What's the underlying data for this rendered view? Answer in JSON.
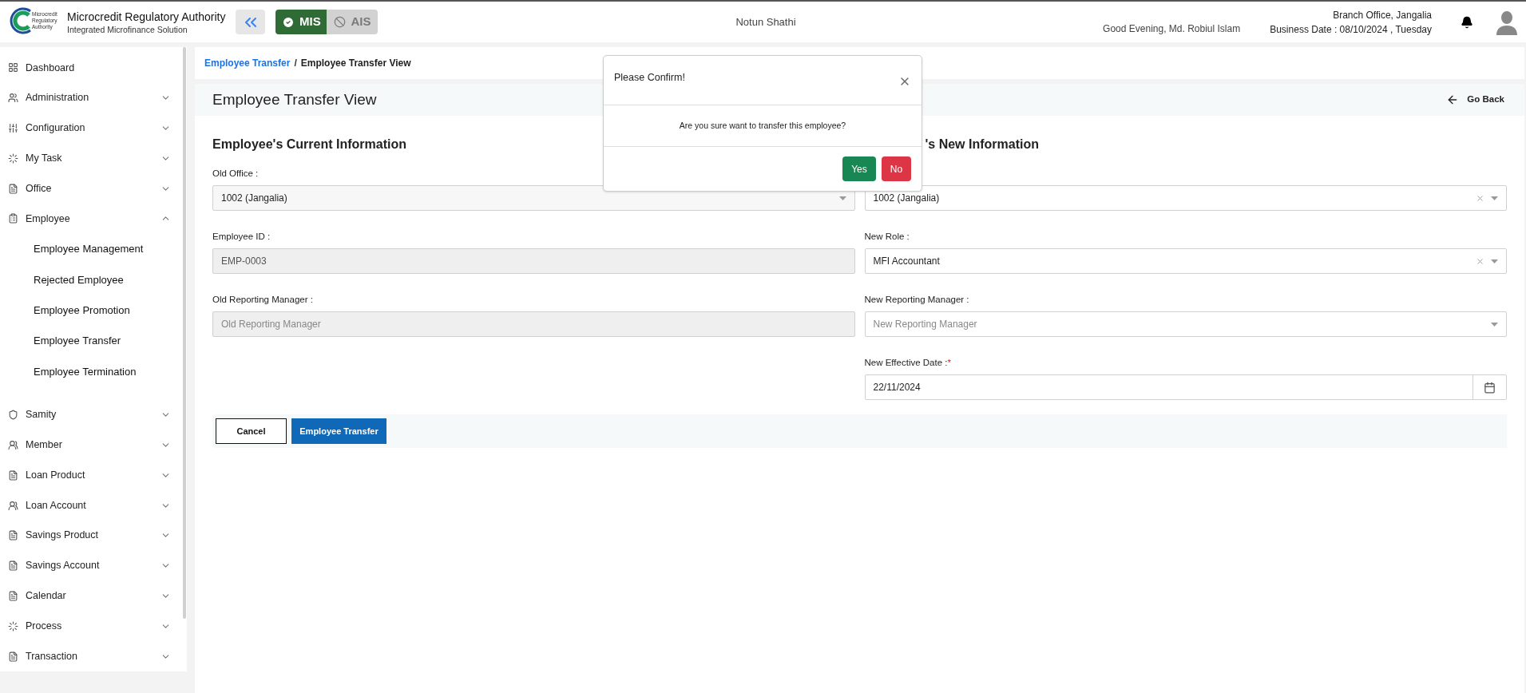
{
  "header": {
    "org_title": "Microcredit Regulatory Authority",
    "org_subtitle": "Integrated Microfinance Solution",
    "logo_text": "Microcredit Regulatory Authority",
    "modes": [
      {
        "label": "MIS",
        "selected": true
      },
      {
        "label": "AIS",
        "selected": false
      }
    ],
    "center_title": "Notun Shathi",
    "greeting": "Good Evening, Md. Robiul Islam",
    "branch": "Branch Office, Jangalia",
    "business_date": "Business Date : 08/10/2024 , Tuesday"
  },
  "sidebar": {
    "items": [
      {
        "label": "Dashboard",
        "kind": "link",
        "expanded": false
      },
      {
        "label": "Administration",
        "kind": "group",
        "expanded": false
      },
      {
        "label": "Configuration",
        "kind": "group",
        "expanded": false
      },
      {
        "label": "My Task",
        "kind": "group",
        "expanded": false
      },
      {
        "label": "Office",
        "kind": "group",
        "expanded": false
      },
      {
        "label": "Employee",
        "kind": "group",
        "expanded": true,
        "children": [
          {
            "label": "Employee Management"
          },
          {
            "label": "Rejected Employee"
          },
          {
            "label": "Employee Promotion"
          },
          {
            "label": "Employee Transfer"
          },
          {
            "label": "Employee Termination"
          }
        ]
      },
      {
        "label": "Samity",
        "kind": "group",
        "expanded": false
      },
      {
        "label": "Member",
        "kind": "group",
        "expanded": false
      },
      {
        "label": "Loan Product",
        "kind": "group",
        "expanded": false
      },
      {
        "label": "Loan Account",
        "kind": "group",
        "expanded": false
      },
      {
        "label": "Savings Product",
        "kind": "group",
        "expanded": false
      },
      {
        "label": "Savings Account",
        "kind": "group",
        "expanded": false
      },
      {
        "label": "Calendar",
        "kind": "group",
        "expanded": false
      },
      {
        "label": "Process",
        "kind": "group",
        "expanded": false
      },
      {
        "label": "Transaction",
        "kind": "group",
        "expanded": false
      }
    ]
  },
  "breadcrumb": {
    "separator": "/",
    "items": [
      {
        "label": "Employee Transfer",
        "kind": "link"
      },
      {
        "label": "Employee Transfer View",
        "kind": "current"
      }
    ]
  },
  "page": {
    "title": "Employee Transfer View",
    "go_back": "Go Back",
    "current": {
      "heading": "Employee's Current Information",
      "fields": [
        {
          "label": "Old Office :",
          "kind": "select",
          "value": "1002 (Jangalia)",
          "disabled": false
        },
        {
          "label": "Employee ID :",
          "kind": "text",
          "value": "EMP-0003",
          "disabled": true
        },
        {
          "label": "Old Reporting Manager :",
          "kind": "text",
          "placeholder": "Old Reporting Manager",
          "disabled": true
        }
      ]
    },
    "new": {
      "heading": "'s New Information",
      "fields": [
        {
          "kind": "select",
          "value": "1002 (Jangalia)",
          "clearable": true,
          "disabled": false
        },
        {
          "label": "New Role :",
          "kind": "select",
          "value": "MFI Accountant",
          "clearable": true,
          "disabled": false
        },
        {
          "label": "New Reporting Manager :",
          "kind": "select",
          "placeholder": "New Reporting Manager",
          "clearable": false,
          "disabled": false
        },
        {
          "label": "New Effective Date :",
          "required_mark": "*",
          "kind": "date",
          "value": "22/11/2024",
          "disabled": false
        }
      ]
    },
    "buttons": [
      {
        "label": "Cancel",
        "kind": "secondary"
      },
      {
        "label": "Employee Transfer",
        "kind": "primary"
      }
    ]
  },
  "dialog": {
    "title": "Please Confirm!",
    "message": "Are you sure want to transfer this employee?",
    "buttons": [
      {
        "label": "Yes",
        "kind": "confirm"
      },
      {
        "label": "No",
        "kind": "cancel"
      }
    ]
  }
}
